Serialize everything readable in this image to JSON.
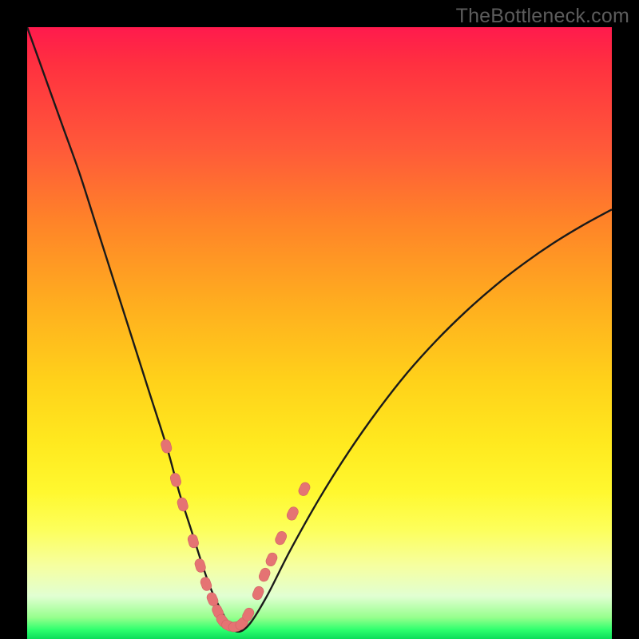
{
  "watermark": "TheBottleneck.com",
  "colors": {
    "background": "#000000",
    "curve_stroke": "#1a1a1a",
    "marker_fill": "#e57373",
    "marker_stroke": "#d06464",
    "gradient_top": "#ff1a4d",
    "gradient_bottom": "#0cdc5a"
  },
  "chart_data": {
    "type": "line",
    "title": "",
    "xlabel": "",
    "ylabel": "",
    "xlim": [
      0,
      100
    ],
    "ylim": [
      0,
      100
    ],
    "x": [
      0,
      3,
      6,
      9,
      12,
      15,
      18,
      21,
      24,
      26,
      28,
      30,
      31.5,
      33,
      34.5,
      36,
      38,
      41,
      45,
      50,
      55,
      60,
      65,
      70,
      75,
      80,
      85,
      90,
      95,
      100
    ],
    "y": [
      100,
      92,
      84,
      76,
      67,
      58,
      49,
      40,
      31,
      24,
      18,
      12,
      8,
      5,
      2.5,
      1.2,
      2.4,
      7,
      14.5,
      23,
      30.6,
      37.4,
      43.5,
      48.8,
      53.5,
      57.7,
      61.4,
      64.7,
      67.6,
      70.2
    ],
    "markers": {
      "x": [
        23.8,
        25.4,
        26.6,
        28.4,
        29.6,
        30.6,
        31.7,
        32.6,
        33.4,
        34.4,
        35.6,
        36.7,
        37.8,
        39.5,
        40.6,
        41.8,
        43.4,
        45.4,
        47.4
      ],
      "y": [
        31.5,
        26.0,
        22.0,
        16.0,
        12.0,
        9.0,
        6.5,
        4.5,
        3.0,
        2.2,
        2.0,
        2.5,
        4.0,
        7.5,
        10.5,
        13.0,
        16.5,
        20.5,
        24.5
      ]
    },
    "legend": false,
    "grid": false
  }
}
